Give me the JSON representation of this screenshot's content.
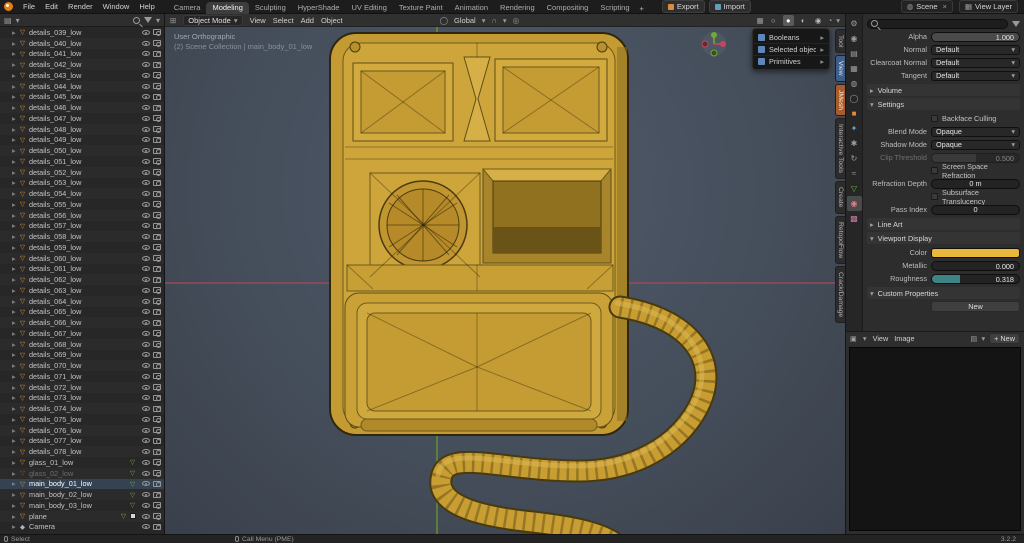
{
  "topbar": {
    "menus": [
      "File",
      "Edit",
      "Render",
      "Window",
      "Help"
    ],
    "tabs": [
      {
        "label": "Camera",
        "cls": ""
      },
      {
        "label": "Modeling",
        "cls": "active"
      },
      {
        "label": "Sculpting",
        "cls": ""
      },
      {
        "label": "HyperShade",
        "cls": ""
      },
      {
        "label": "UV Editing",
        "cls": ""
      },
      {
        "label": "Texture Paint",
        "cls": ""
      },
      {
        "label": "Animation",
        "cls": ""
      },
      {
        "label": "Rendering",
        "cls": ""
      },
      {
        "label": "Compositing",
        "cls": ""
      },
      {
        "label": "Scripting",
        "cls": ""
      },
      {
        "label": "+",
        "cls": "plus"
      }
    ],
    "export_label": "Export",
    "import_label": "Import",
    "scene_label": "Scene",
    "view_layer_label": "View Layer"
  },
  "outliner": {
    "rows": [
      {
        "label": "details_039_low",
        "cls": ""
      },
      {
        "label": "details_040_low",
        "cls": ""
      },
      {
        "label": "details_041_low",
        "cls": ""
      },
      {
        "label": "details_042_low",
        "cls": ""
      },
      {
        "label": "details_043_low",
        "cls": ""
      },
      {
        "label": "details_044_low",
        "cls": ""
      },
      {
        "label": "details_045_low",
        "cls": ""
      },
      {
        "label": "details_046_low",
        "cls": ""
      },
      {
        "label": "details_047_low",
        "cls": ""
      },
      {
        "label": "details_048_low",
        "cls": ""
      },
      {
        "label": "details_049_low",
        "cls": ""
      },
      {
        "label": "details_050_low",
        "cls": ""
      },
      {
        "label": "details_051_low",
        "cls": ""
      },
      {
        "label": "details_052_low",
        "cls": ""
      },
      {
        "label": "details_053_low",
        "cls": ""
      },
      {
        "label": "details_054_low",
        "cls": ""
      },
      {
        "label": "details_055_low",
        "cls": ""
      },
      {
        "label": "details_056_low",
        "cls": ""
      },
      {
        "label": "details_057_low",
        "cls": ""
      },
      {
        "label": "details_058_low",
        "cls": ""
      },
      {
        "label": "details_059_low",
        "cls": ""
      },
      {
        "label": "details_060_low",
        "cls": ""
      },
      {
        "label": "details_061_low",
        "cls": ""
      },
      {
        "label": "details_062_low",
        "cls": ""
      },
      {
        "label": "details_063_low",
        "cls": ""
      },
      {
        "label": "details_064_low",
        "cls": ""
      },
      {
        "label": "details_065_low",
        "cls": ""
      },
      {
        "label": "details_066_low",
        "cls": ""
      },
      {
        "label": "details_067_low",
        "cls": ""
      },
      {
        "label": "details_068_low",
        "cls": ""
      },
      {
        "label": "details_069_low",
        "cls": ""
      },
      {
        "label": "details_070_low",
        "cls": ""
      },
      {
        "label": "details_071_low",
        "cls": ""
      },
      {
        "label": "details_072_low",
        "cls": ""
      },
      {
        "label": "details_073_low",
        "cls": ""
      },
      {
        "label": "details_074_low",
        "cls": ""
      },
      {
        "label": "details_075_low",
        "cls": ""
      },
      {
        "label": "details_076_low",
        "cls": ""
      },
      {
        "label": "details_077_low",
        "cls": ""
      },
      {
        "label": "details_078_low",
        "cls": ""
      },
      {
        "label": "glass_01_low",
        "cls": "hasdata"
      },
      {
        "label": "glass_02_low",
        "cls": "hasdata dim"
      },
      {
        "label": "main_body_01_low",
        "cls": "hasdata active"
      },
      {
        "label": "main_body_02_low",
        "cls": "hasdata"
      },
      {
        "label": "main_body_03_low",
        "cls": "hasdata"
      },
      {
        "label": "plane",
        "cls": "hasdata has-check"
      },
      {
        "label": "Camera",
        "cls": "camera-row"
      }
    ]
  },
  "viewport": {
    "header": {
      "mode": "Object Mode",
      "menus": [
        "View",
        "Select",
        "Add",
        "Object"
      ],
      "orientation": "Global"
    },
    "overlay_line1": "User Orthographic",
    "overlay_line2": "(2) Scene Collection | main_body_01_low",
    "popup": {
      "items": [
        {
          "label": "Booleans"
        },
        {
          "label": "Selected objects"
        },
        {
          "label": "Primitives"
        }
      ]
    },
    "side_tabs": [
      {
        "label": "Tool",
        "cls": ""
      },
      {
        "label": "View",
        "cls": "tab-blue"
      },
      {
        "label": "JMesh",
        "cls": "tab-orange"
      },
      {
        "label": "Interactive Tools",
        "cls": ""
      },
      {
        "label": "Create",
        "cls": ""
      },
      {
        "label": "RetopoFlow",
        "cls": ""
      },
      {
        "label": "Crack/Damage",
        "cls": ""
      }
    ],
    "colors": {
      "axis_x": "#a8485a",
      "axis_y": "#6d9e2c",
      "model_gold": "#c9a137"
    }
  },
  "properties": {
    "tabs": [
      {
        "name": "tool-properties-icon",
        "glyph": "⚙",
        "color": "#9e9e9e",
        "cls": ""
      },
      {
        "name": "render-properties-icon",
        "glyph": "◉",
        "color": "#9e9e9e",
        "cls": ""
      },
      {
        "name": "output-properties-icon",
        "glyph": "▤",
        "color": "#9e9e9e",
        "cls": ""
      },
      {
        "name": "view-layer-properties-icon",
        "glyph": "▦",
        "color": "#9e9e9e",
        "cls": ""
      },
      {
        "name": "scene-properties-icon",
        "glyph": "◍",
        "color": "#9e9e9e",
        "cls": ""
      },
      {
        "name": "world-properties-icon",
        "glyph": "◯",
        "color": "#9e9e9e",
        "cls": ""
      },
      {
        "name": "object-properties-icon",
        "glyph": "■",
        "color": "#e08b3a",
        "cls": ""
      },
      {
        "name": "modifier-properties-icon",
        "glyph": "✦",
        "color": "#6f9fd8",
        "cls": ""
      },
      {
        "name": "particles-properties-icon",
        "glyph": "✱",
        "color": "#9e9e9e",
        "cls": ""
      },
      {
        "name": "physics-properties-icon",
        "glyph": "↻",
        "color": "#9e9e9e",
        "cls": ""
      },
      {
        "name": "constraints-properties-icon",
        "glyph": "≈",
        "color": "#9e9e9e",
        "cls": ""
      },
      {
        "name": "object-data-properties-icon",
        "glyph": "▽",
        "color": "#74b344",
        "cls": ""
      },
      {
        "name": "material-properties-icon",
        "glyph": "◉",
        "color": "#e57c8a",
        "cls": "active"
      },
      {
        "name": "texture-properties-icon",
        "glyph": "▩",
        "color": "#c27ba0",
        "cls": ""
      }
    ],
    "alpha": {
      "label": "Alpha",
      "value": "1.000"
    },
    "normal": {
      "label": "Normal",
      "value": "Default"
    },
    "clearcoat_normal": {
      "label": "Clearcoat Normal",
      "value": "Default"
    },
    "tangent": {
      "label": "Tangent",
      "value": "Default"
    },
    "panels": {
      "volume": "Volume",
      "settings": "Settings",
      "line_art": "Line Art",
      "viewport_display": "Viewport Display",
      "custom_properties": "Custom Properties"
    },
    "settings": {
      "backface_culling": "Backface Culling",
      "blend_mode_label": "Blend Mode",
      "blend_mode_value": "Opaque",
      "shadow_mode_label": "Shadow Mode",
      "shadow_mode_value": "Opaque",
      "clip_threshold_label": "Clip Threshold",
      "clip_threshold_value": "0.500",
      "ssr_label": "Screen Space Refraction",
      "refraction_depth_label": "Refraction Depth",
      "refraction_depth_value": "0 m",
      "subsurface_label": "Subsurface Translucency",
      "pass_index_label": "Pass Index",
      "pass_index_value": "0"
    },
    "viewport_display": {
      "color_label": "Color",
      "color_hex": "#e8b83d",
      "metallic_label": "Metallic",
      "metallic_value": "0.000",
      "roughness_label": "Roughness",
      "roughness_value": "0.318"
    },
    "custom_properties": {
      "new_label": "New"
    }
  },
  "image_editor": {
    "menus": [
      "View",
      "Image"
    ],
    "new_label": "New"
  },
  "statusbar": {
    "left": "Select",
    "menu_hint": "Call Menu (PME)",
    "version": "3.2.2"
  }
}
